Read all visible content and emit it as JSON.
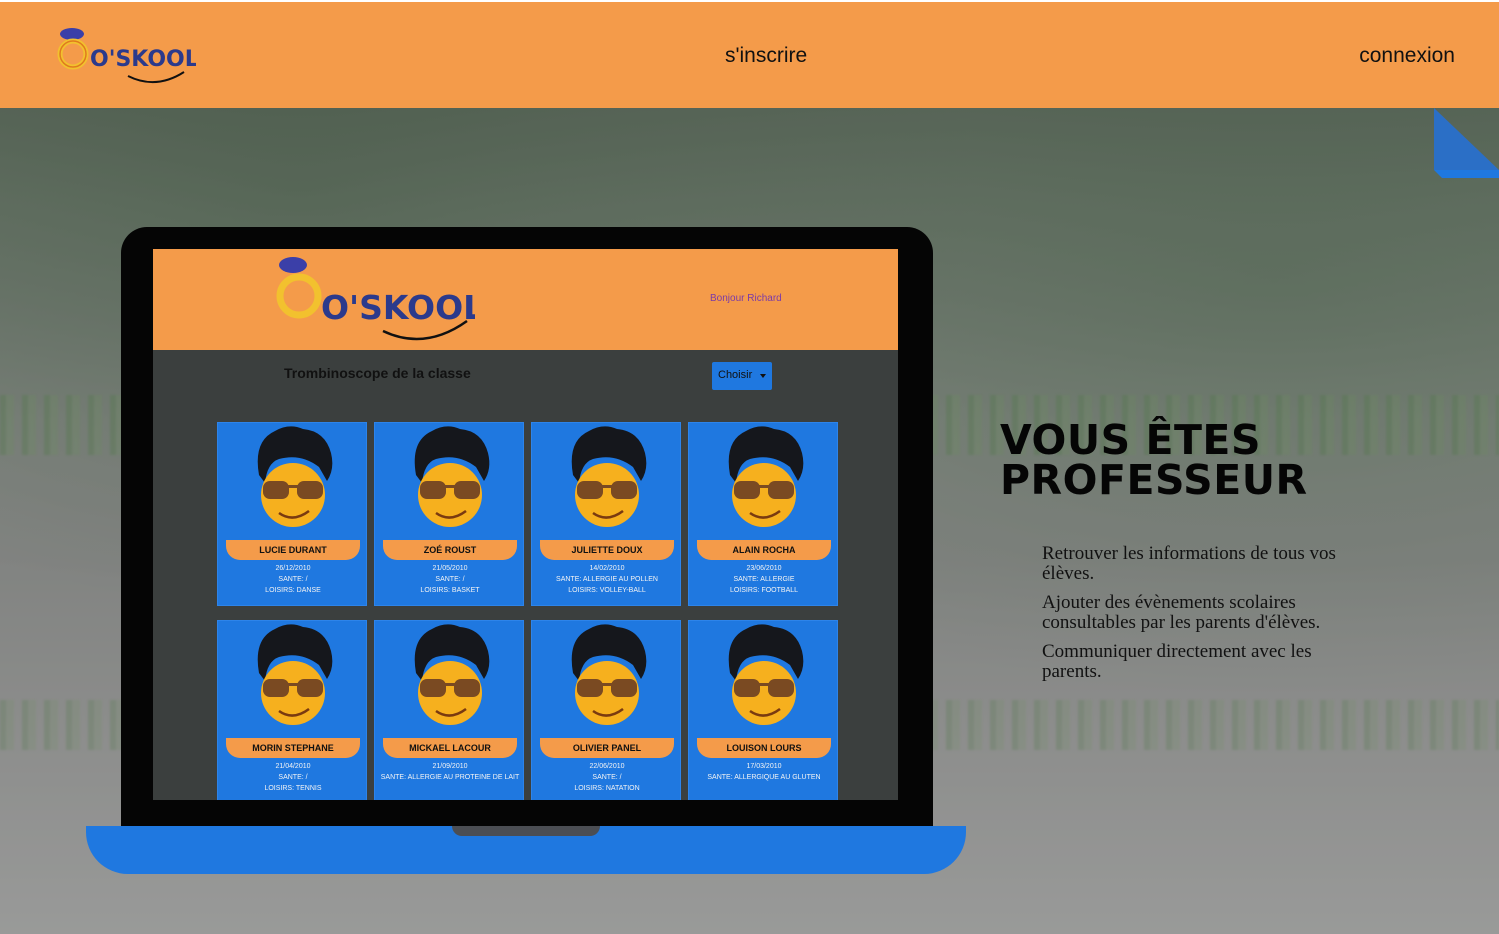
{
  "header": {
    "logo_text": "O'SKOOL",
    "nav": {
      "signup": "s'inscrire",
      "login": "connexion"
    }
  },
  "colors": {
    "brand_orange": "#f49b4a",
    "brand_blue": "#1f78e0"
  },
  "laptop": {
    "app": {
      "logo_text": "O'SKOOL",
      "greeting": "Bonjour Richard",
      "title": "Trombinoscope de la classe",
      "select_label": "Choisir",
      "students": [
        {
          "name": "LUCIE DURANT",
          "birth": "26/12/2010",
          "health": "SANTE: /",
          "hobbies": "LOISIRS: DANSE"
        },
        {
          "name": "ZOÉ ROUST",
          "birth": "21/05/2010",
          "health": "SANTE: /",
          "hobbies": "LOISIRS: BASKET"
        },
        {
          "name": "JULIETTE DOUX",
          "birth": "14/02/2010",
          "health": "SANTE: ALLERGIE AU POLLEN",
          "hobbies": "LOISIRS: VOLLEY-BALL"
        },
        {
          "name": "ALAIN ROCHA",
          "birth": "23/06/2010",
          "health": "SANTE: ALLERGIE",
          "hobbies": "LOISIRS: FOOTBALL"
        },
        {
          "name": "MORIN STEPHANE",
          "birth": "21/04/2010",
          "health": "SANTE: /",
          "hobbies": "LOISIRS: TENNIS"
        },
        {
          "name": "MICKAEL LACOUR",
          "birth": "21/09/2010",
          "health": "SANTE: ALLERGIE AU PROTEINE DE LAIT",
          "hobbies": ""
        },
        {
          "name": "OLIVIER PANEL",
          "birth": "22/06/2010",
          "health": "SANTE: /",
          "hobbies": "LOISIRS: NATATION"
        },
        {
          "name": "LOUISON LOURS",
          "birth": "17/03/2010",
          "health": "SANTE: ALLERGIQUE AU GLUTEN",
          "hobbies": ""
        }
      ]
    }
  },
  "hero": {
    "title": "VOUS ÊTES PROFESSEUR",
    "features": [
      "Retrouver les informations de tous vos élèves.",
      "Ajouter des évènements scolaires consultables par les parents d'élèves.",
      "Communiquer directement avec les parents."
    ]
  }
}
